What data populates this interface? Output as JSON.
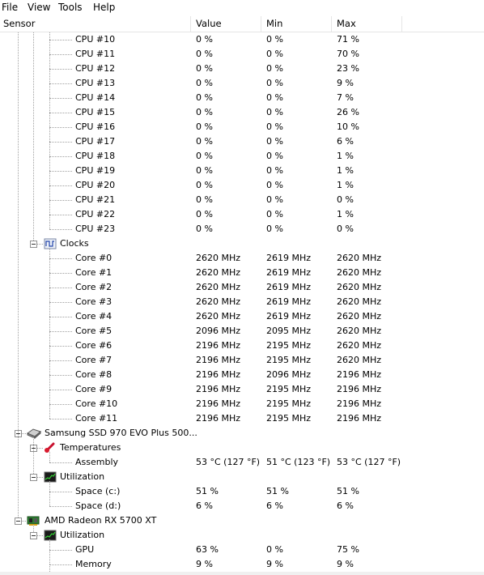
{
  "menu": [
    "File",
    "View",
    "Tools",
    "Help"
  ],
  "columns": [
    "Sensor",
    "Value",
    "Min",
    "Max"
  ],
  "rows": [
    {
      "label": "CPU #10",
      "value": "0 %",
      "min": "0 %",
      "max": "71 %",
      "level": 3,
      "kind": "leaf",
      "selected": true
    },
    {
      "label": "CPU #11",
      "value": "0 %",
      "min": "0 %",
      "max": "70 %",
      "level": 3,
      "kind": "leaf"
    },
    {
      "label": "CPU #12",
      "value": "0 %",
      "min": "0 %",
      "max": "23 %",
      "level": 3,
      "kind": "leaf"
    },
    {
      "label": "CPU #13",
      "value": "0 %",
      "min": "0 %",
      "max": "9 %",
      "level": 3,
      "kind": "leaf"
    },
    {
      "label": "CPU #14",
      "value": "0 %",
      "min": "0 %",
      "max": "7 %",
      "level": 3,
      "kind": "leaf"
    },
    {
      "label": "CPU #15",
      "value": "0 %",
      "min": "0 %",
      "max": "26 %",
      "level": 3,
      "kind": "leaf"
    },
    {
      "label": "CPU #16",
      "value": "0 %",
      "min": "0 %",
      "max": "10 %",
      "level": 3,
      "kind": "leaf"
    },
    {
      "label": "CPU #17",
      "value": "0 %",
      "min": "0 %",
      "max": "6 %",
      "level": 3,
      "kind": "leaf"
    },
    {
      "label": "CPU #18",
      "value": "0 %",
      "min": "0 %",
      "max": "1 %",
      "level": 3,
      "kind": "leaf"
    },
    {
      "label": "CPU #19",
      "value": "0 %",
      "min": "0 %",
      "max": "1 %",
      "level": 3,
      "kind": "leaf"
    },
    {
      "label": "CPU #20",
      "value": "0 %",
      "min": "0 %",
      "max": "1 %",
      "level": 3,
      "kind": "leaf"
    },
    {
      "label": "CPU #21",
      "value": "0 %",
      "min": "0 %",
      "max": "0 %",
      "level": 3,
      "kind": "leaf"
    },
    {
      "label": "CPU #22",
      "value": "0 %",
      "min": "0 %",
      "max": "1 %",
      "level": 3,
      "kind": "leaf"
    },
    {
      "label": "CPU #23",
      "value": "0 %",
      "min": "0 %",
      "max": "0 %",
      "level": 3,
      "kind": "leaf",
      "lastChild": true
    },
    {
      "label": "Clocks",
      "level": 2,
      "kind": "group",
      "icon": "clock-wave-icon"
    },
    {
      "label": "Core #0",
      "value": "2620 MHz",
      "min": "2619 MHz",
      "max": "2620 MHz",
      "level": 3,
      "kind": "leaf"
    },
    {
      "label": "Core #1",
      "value": "2620 MHz",
      "min": "2619 MHz",
      "max": "2620 MHz",
      "level": 3,
      "kind": "leaf"
    },
    {
      "label": "Core #2",
      "value": "2620 MHz",
      "min": "2619 MHz",
      "max": "2620 MHz",
      "level": 3,
      "kind": "leaf"
    },
    {
      "label": "Core #3",
      "value": "2620 MHz",
      "min": "2619 MHz",
      "max": "2620 MHz",
      "level": 3,
      "kind": "leaf"
    },
    {
      "label": "Core #4",
      "value": "2620 MHz",
      "min": "2619 MHz",
      "max": "2620 MHz",
      "level": 3,
      "kind": "leaf"
    },
    {
      "label": "Core #5",
      "value": "2096 MHz",
      "min": "2095 MHz",
      "max": "2620 MHz",
      "level": 3,
      "kind": "leaf"
    },
    {
      "label": "Core #6",
      "value": "2196 MHz",
      "min": "2195 MHz",
      "max": "2620 MHz",
      "level": 3,
      "kind": "leaf"
    },
    {
      "label": "Core #7",
      "value": "2196 MHz",
      "min": "2195 MHz",
      "max": "2620 MHz",
      "level": 3,
      "kind": "leaf"
    },
    {
      "label": "Core #8",
      "value": "2196 MHz",
      "min": "2096 MHz",
      "max": "2196 MHz",
      "level": 3,
      "kind": "leaf"
    },
    {
      "label": "Core #9",
      "value": "2196 MHz",
      "min": "2195 MHz",
      "max": "2196 MHz",
      "level": 3,
      "kind": "leaf"
    },
    {
      "label": "Core #10",
      "value": "2196 MHz",
      "min": "2195 MHz",
      "max": "2196 MHz",
      "level": 3,
      "kind": "leaf"
    },
    {
      "label": "Core #11",
      "value": "2196 MHz",
      "min": "2195 MHz",
      "max": "2196 MHz",
      "level": 3,
      "kind": "leaf",
      "lastChild": true
    },
    {
      "label": "Samsung SSD 970 EVO Plus 500...",
      "level": 1,
      "kind": "device",
      "icon": "ssd-drive-icon"
    },
    {
      "label": "Temperatures",
      "level": 2,
      "kind": "group",
      "icon": "thermometer-icon"
    },
    {
      "label": "Assembly",
      "value": "53 °C  (127 °F)",
      "min": "51 °C  (123 °F)",
      "max": "53 °C  (127 °F)",
      "level": 3,
      "kind": "leaf",
      "lastChild": true
    },
    {
      "label": "Utilization",
      "level": 2,
      "kind": "group",
      "icon": "utilization-monitor-icon"
    },
    {
      "label": "Space (c:)",
      "value": "51 %",
      "min": "51 %",
      "max": "51 %",
      "level": 3,
      "kind": "leaf"
    },
    {
      "label": "Space (d:)",
      "value": "6 %",
      "min": "6 %",
      "max": "6 %",
      "level": 3,
      "kind": "leaf",
      "lastChild": true
    },
    {
      "label": "AMD Radeon RX 5700 XT",
      "level": 1,
      "kind": "device",
      "icon": "gpu-card-icon"
    },
    {
      "label": "Utilization",
      "level": 2,
      "kind": "group",
      "icon": "utilization-monitor-icon"
    },
    {
      "label": "GPU",
      "value": "63 %",
      "min": "0 %",
      "max": "75 %",
      "level": 3,
      "kind": "leaf"
    },
    {
      "label": "Memory",
      "value": "9 %",
      "min": "9 %",
      "max": "9 %",
      "level": 3,
      "kind": "leaf"
    }
  ]
}
